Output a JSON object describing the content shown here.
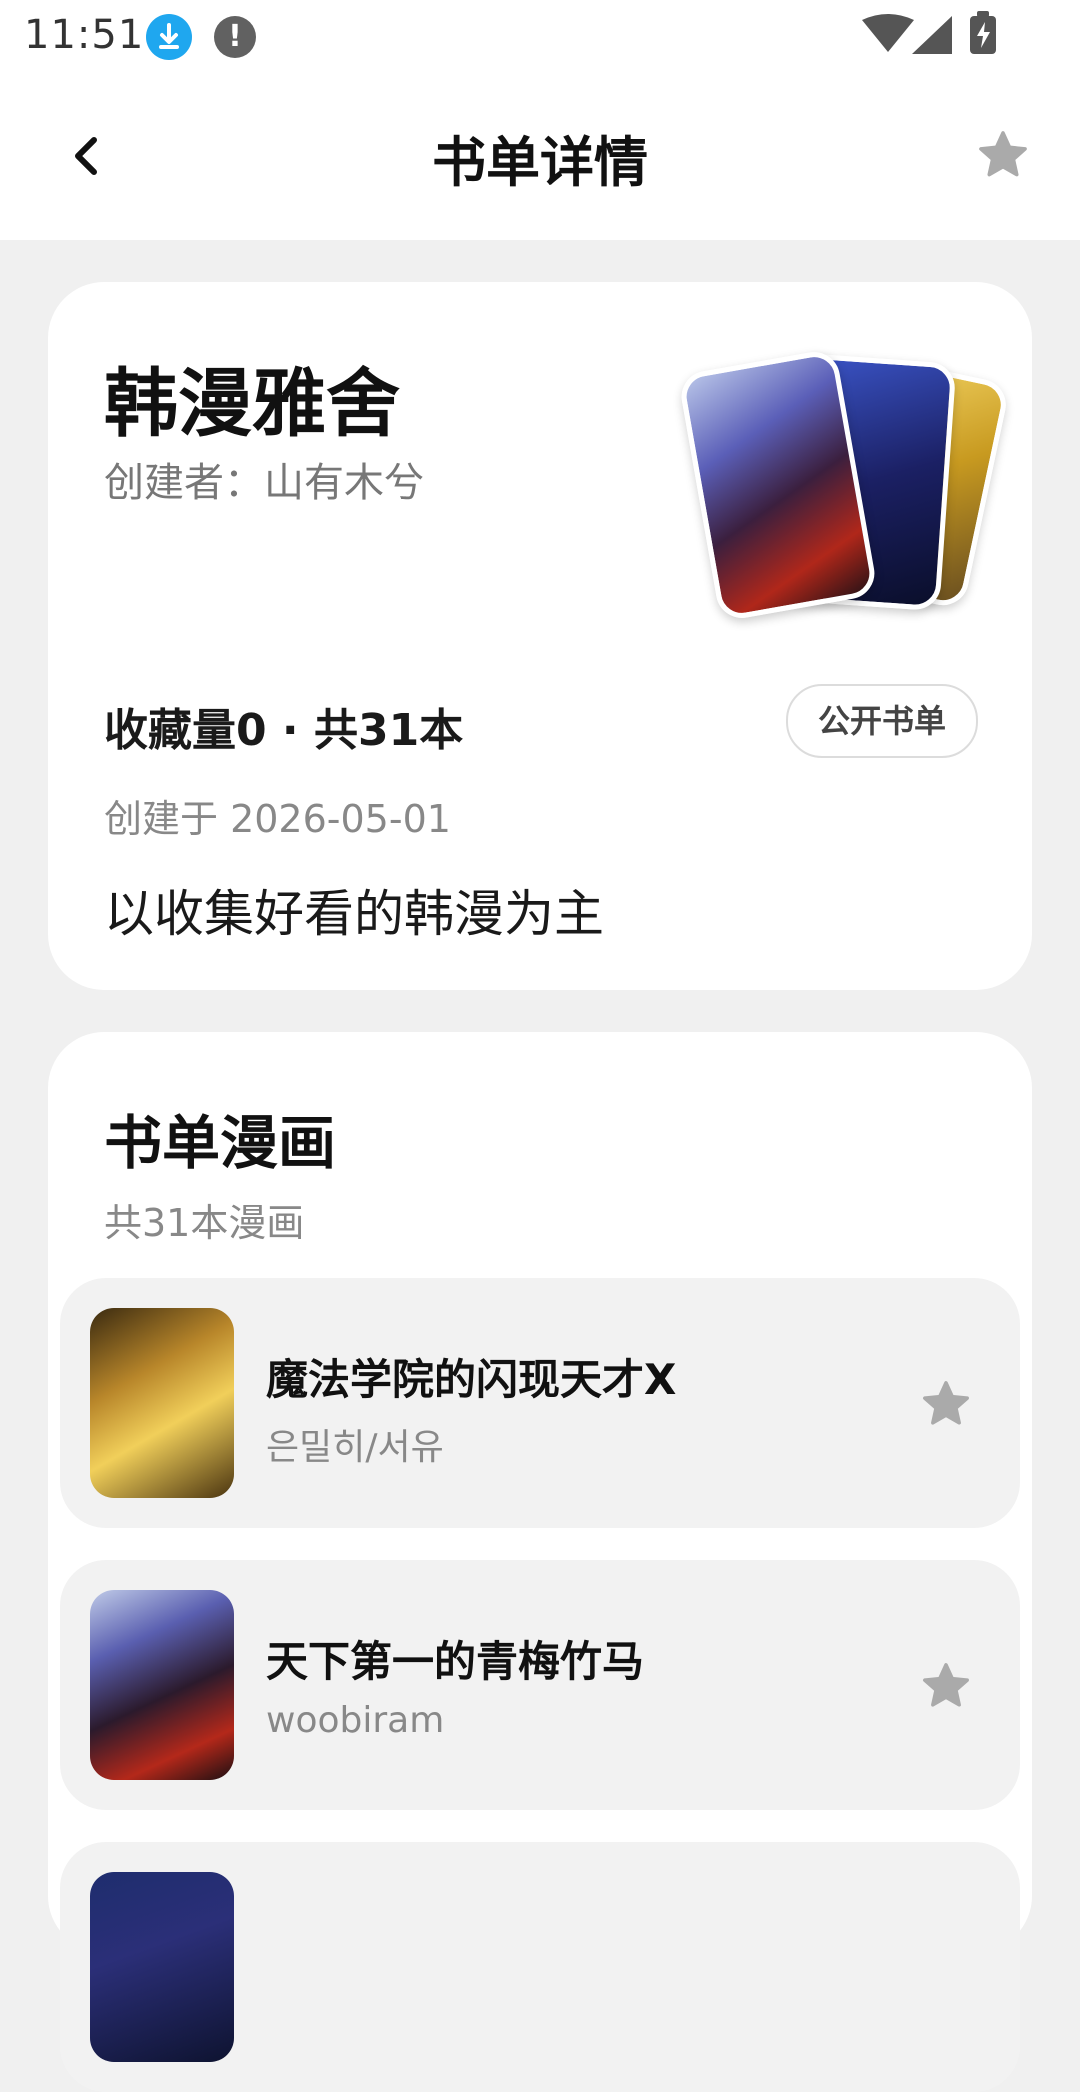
{
  "status_bar": {
    "time": "11:51",
    "alert_symbol": "!",
    "icons": [
      "download-icon",
      "alert-icon",
      "wifi-icon",
      "signal-icon",
      "battery-charging-icon"
    ]
  },
  "header": {
    "title": "书单详情",
    "back_icon": "chevron-left-icon",
    "favorite_icon": "star-icon"
  },
  "booklist": {
    "name": "韩漫雅舍",
    "creator": "创建者：山有木兮",
    "stats": "收藏量0 · 共31本",
    "public_label": "公开书单",
    "created": "创建于 2026-05-01",
    "description": "以收集好看的韩漫为主"
  },
  "comics": {
    "section_title": "书单漫画",
    "count_text": "共31本漫画",
    "items": [
      {
        "title": "魔法学院的闪现天才X",
        "author": "은밀히/서유"
      },
      {
        "title": "天下第一的青梅竹马",
        "author": "woobiram"
      },
      {
        "title": "",
        "author": ""
      }
    ]
  },
  "colors": {
    "background": "#f0f0f0",
    "card": "#ffffff",
    "item_background": "#f2f2f2",
    "star_inactive": "#aaaaaa",
    "download_badge": "#1fa7ef"
  }
}
